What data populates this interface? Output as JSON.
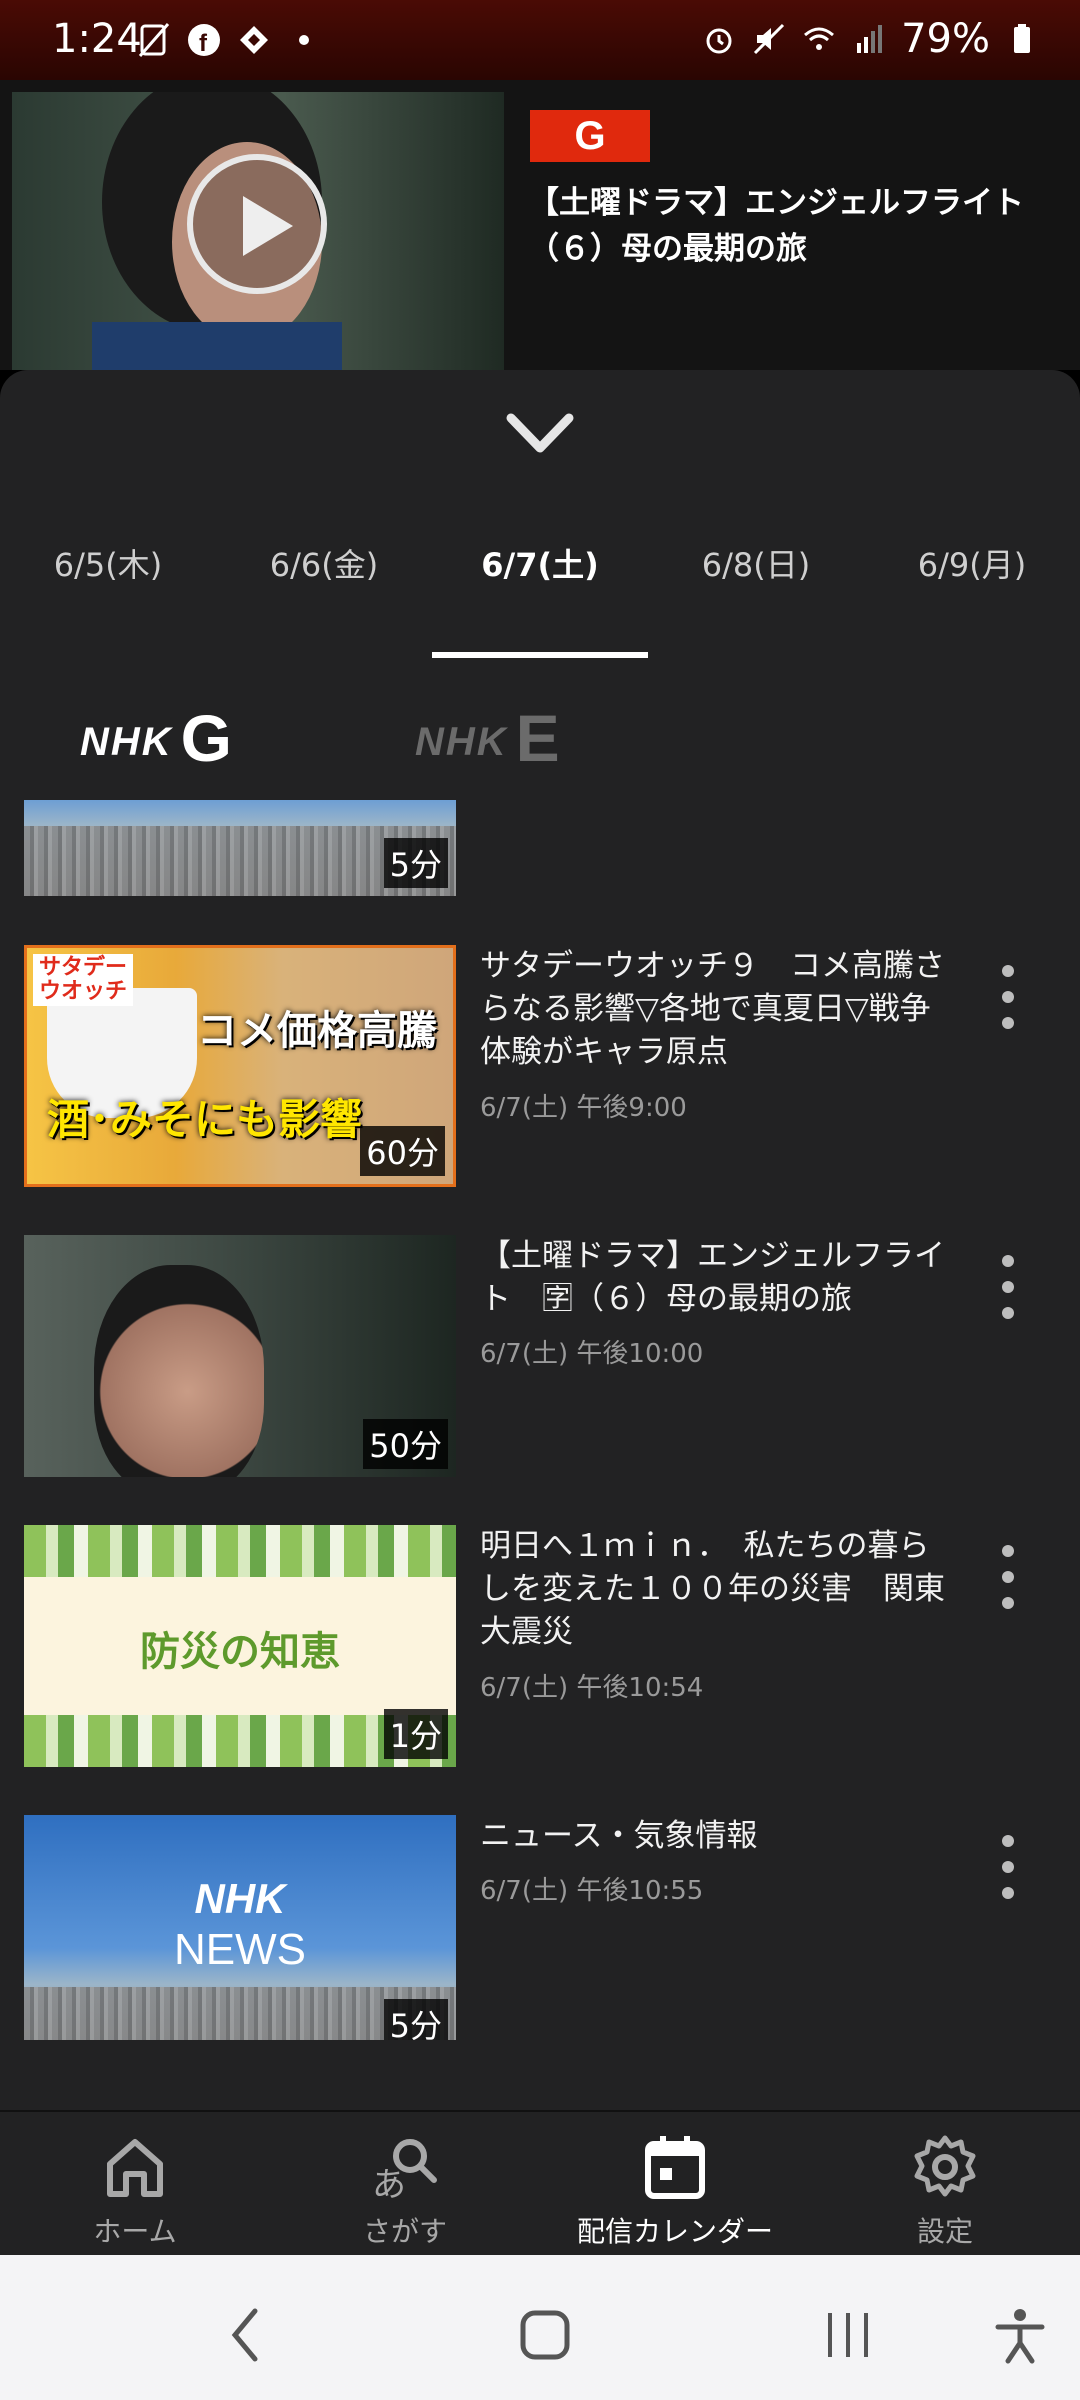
{
  "status_bar": {
    "time": "1:24",
    "battery": "79%"
  },
  "mini_player": {
    "channel_badge": "G",
    "title": "【土曜ドラマ】エンジェルフライト（６）母の最期の旅"
  },
  "date_tabs": [
    {
      "label": "6/5(木)"
    },
    {
      "label": "6/6(金)"
    },
    {
      "label": "6/7(土)",
      "active": true
    },
    {
      "label": "6/8(日)"
    },
    {
      "label": "6/9(月)"
    }
  ],
  "channels": {
    "g": {
      "brand": "NHK",
      "letter": "G"
    },
    "e": {
      "brand": "NHK",
      "letter": "E"
    }
  },
  "programs": {
    "partial": {
      "duration": "5分"
    },
    "items": [
      {
        "title": "サタデーウオッチ９　コメ高騰さらなる影響▽各地で真夏日▽戦争体験がキャラ原点",
        "time": "6/7(土) 午後9:00",
        "duration": "60分",
        "thumb": {
          "tag_line1": "サタデー",
          "tag_line2": "ウオッチ",
          "line1": "コメ価格高騰",
          "line2": "酒･みそにも影響"
        }
      },
      {
        "title": "【土曜ドラマ】エンジェルフライト　🈑（６）母の最期の旅",
        "time": "6/7(土) 午後10:00",
        "duration": "50分"
      },
      {
        "title": "明日へ１ｍｉｎ．　私たちの暮らしを変えた１００年の災害　関東大震災",
        "time": "6/7(土) 午後10:54",
        "duration": "1分",
        "thumb": {
          "text": "防災の知恵"
        }
      },
      {
        "title": "ニュース・気象情報",
        "time": "6/7(土) 午後10:55",
        "duration": "5分",
        "thumb": {
          "line1": "NHK",
          "line2": "NEWS"
        }
      }
    ]
  },
  "bottom_nav": [
    {
      "label": "ホーム",
      "icon": "home-icon"
    },
    {
      "label": "さがす",
      "icon": "search-icon"
    },
    {
      "label": "配信カレンダー",
      "icon": "calendar-icon",
      "active": true
    },
    {
      "label": "設定",
      "icon": "gear-icon"
    }
  ],
  "colors": {
    "accent": "#e0290d",
    "sheet_bg": "#222223",
    "status_bg": "#3a0804"
  }
}
